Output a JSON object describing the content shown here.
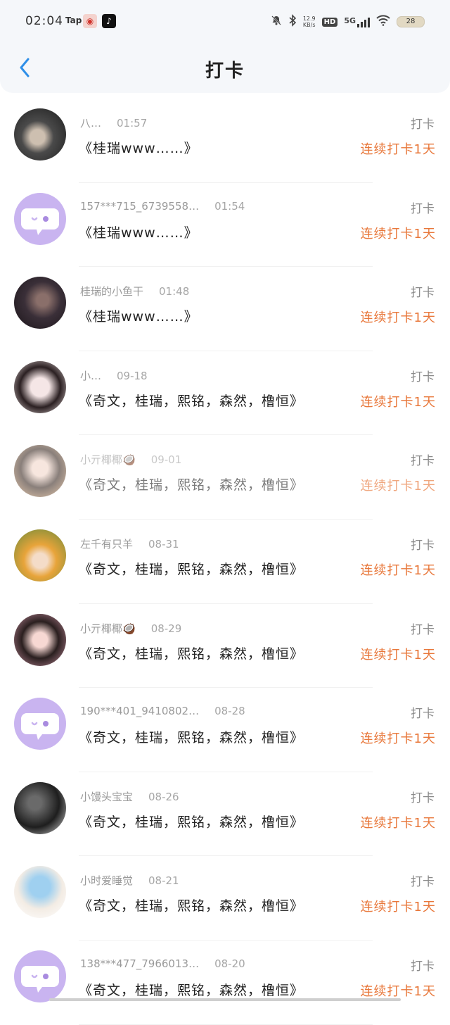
{
  "status_bar": {
    "time": "02:04",
    "tap_label": "Tap",
    "net_speed_value": "12.9",
    "net_speed_unit": "KB/s",
    "hd": "HD",
    "network": "5G",
    "battery": "28"
  },
  "header": {
    "title": "打卡",
    "back_icon": "chevron-left-icon"
  },
  "items": [
    {
      "name": "八…",
      "time": "01:57",
      "text": "《桂瑞www……》",
      "action": "打卡",
      "streak": "连续打卡1天",
      "avatar": "photo"
    },
    {
      "name": "157***715_6739558…",
      "time": "01:54",
      "text": "《桂瑞www……》",
      "action": "打卡",
      "streak": "连续打卡1天",
      "avatar": "default"
    },
    {
      "name": "桂瑞的小鱼干",
      "time": "01:48",
      "text": "《桂瑞www……》",
      "action": "打卡",
      "streak": "连续打卡1天",
      "avatar": "photo"
    },
    {
      "name": "小…",
      "time": "09-18",
      "text": "《奇文，桂瑞，熙铭，森然，橹恒》",
      "action": "打卡",
      "streak": "连续打卡1天",
      "avatar": "photo"
    },
    {
      "name": "小亓椰椰🥥",
      "time": "09-01",
      "text": "《奇文，桂瑞，熙铭，森然，橹恒》",
      "action": "打卡",
      "streak": "连续打卡1天",
      "avatar": "photo"
    },
    {
      "name": "左千有只羊",
      "time": "08-31",
      "text": "《奇文，桂瑞，熙铭，森然，橹恒》",
      "action": "打卡",
      "streak": "连续打卡1天",
      "avatar": "photo"
    },
    {
      "name": "小亓椰椰🥥",
      "time": "08-29",
      "text": "《奇文，桂瑞，熙铭，森然，橹恒》",
      "action": "打卡",
      "streak": "连续打卡1天",
      "avatar": "photo"
    },
    {
      "name": "190***401_9410802…",
      "time": "08-28",
      "text": "《奇文，桂瑞，熙铭，森然，橹恒》",
      "action": "打卡",
      "streak": "连续打卡1天",
      "avatar": "default"
    },
    {
      "name": "小馒头宝宝",
      "time": "08-26",
      "text": "《奇文，桂瑞，熙铭，森然，橹恒》",
      "action": "打卡",
      "streak": "连续打卡1天",
      "avatar": "photo"
    },
    {
      "name": "小时爱睡觉",
      "time": "08-21",
      "text": "《奇文，桂瑞，熙铭，森然，橹恒》",
      "action": "打卡",
      "streak": "连续打卡1天",
      "avatar": "photo"
    },
    {
      "name": "138***477_7966013…",
      "time": "08-20",
      "text": "《奇文，桂瑞，熙铭，森然，橹恒》",
      "action": "打卡",
      "streak": "连续打卡1天",
      "avatar": "default"
    }
  ],
  "colors": {
    "accent": "#e8773a",
    "back_arrow": "#2f8fe8",
    "default_avatar_bg": "#c9b4f0"
  }
}
